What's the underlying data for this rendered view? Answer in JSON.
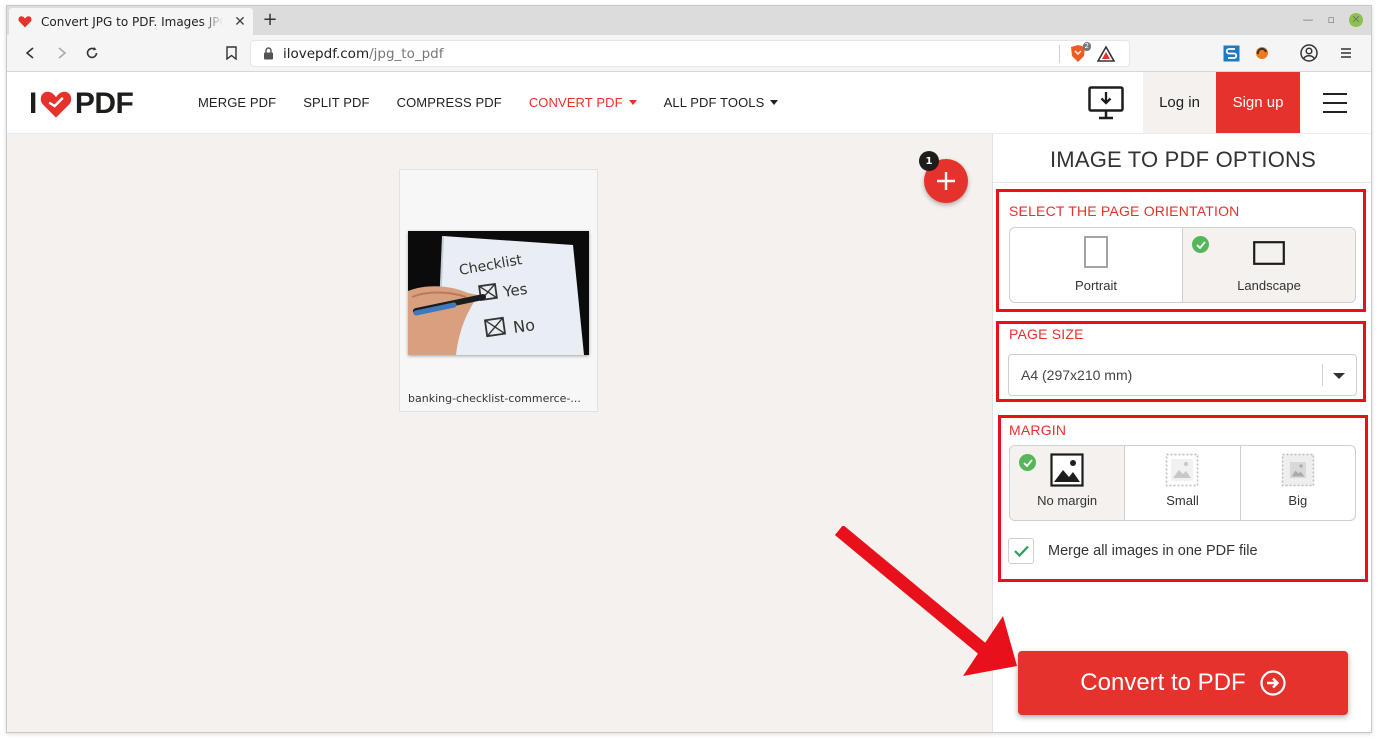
{
  "browser": {
    "tab_title": "Convert JPG to PDF. Images JPG to PDF",
    "new_tab": "+",
    "tab_close": "✕",
    "url_domain": "ilovepdf.com",
    "url_path": "/jpg_to_pdf",
    "brave_badge": "2"
  },
  "header": {
    "logo_left": "I",
    "logo_right": "PDF",
    "nav": [
      {
        "label": "MERGE PDF"
      },
      {
        "label": "SPLIT PDF"
      },
      {
        "label": "COMPRESS PDF"
      },
      {
        "label": "CONVERT PDF"
      },
      {
        "label": "ALL PDF TOOLS"
      }
    ],
    "login": "Log in",
    "signup": "Sign up"
  },
  "workspace": {
    "file_count": "1",
    "file_name": "banking-checklist-commerce-...",
    "image_text": {
      "title": "Checklist",
      "yes": "Yes",
      "no": "No"
    }
  },
  "sidebar": {
    "title": "IMAGE TO PDF OPTIONS",
    "orientation": {
      "title": "SELECT THE PAGE ORIENTATION",
      "options": [
        {
          "label": "Portrait"
        },
        {
          "label": "Landscape"
        }
      ],
      "selected": "Landscape"
    },
    "page_size": {
      "title": "PAGE SIZE",
      "value": "A4 (297x210 mm)"
    },
    "margin": {
      "title": "MARGIN",
      "options": [
        {
          "label": "No margin"
        },
        {
          "label": "Small"
        },
        {
          "label": "Big"
        }
      ],
      "selected": "No margin"
    },
    "merge_label": "Merge all images in one PDF file",
    "merge_checked": true,
    "convert_label": "Convert to PDF"
  },
  "colors": {
    "brand_red": "#e5322d",
    "annotation_red": "#e8101a",
    "check_green": "#55b65a",
    "workspace_bg": "#f4f1ee"
  }
}
